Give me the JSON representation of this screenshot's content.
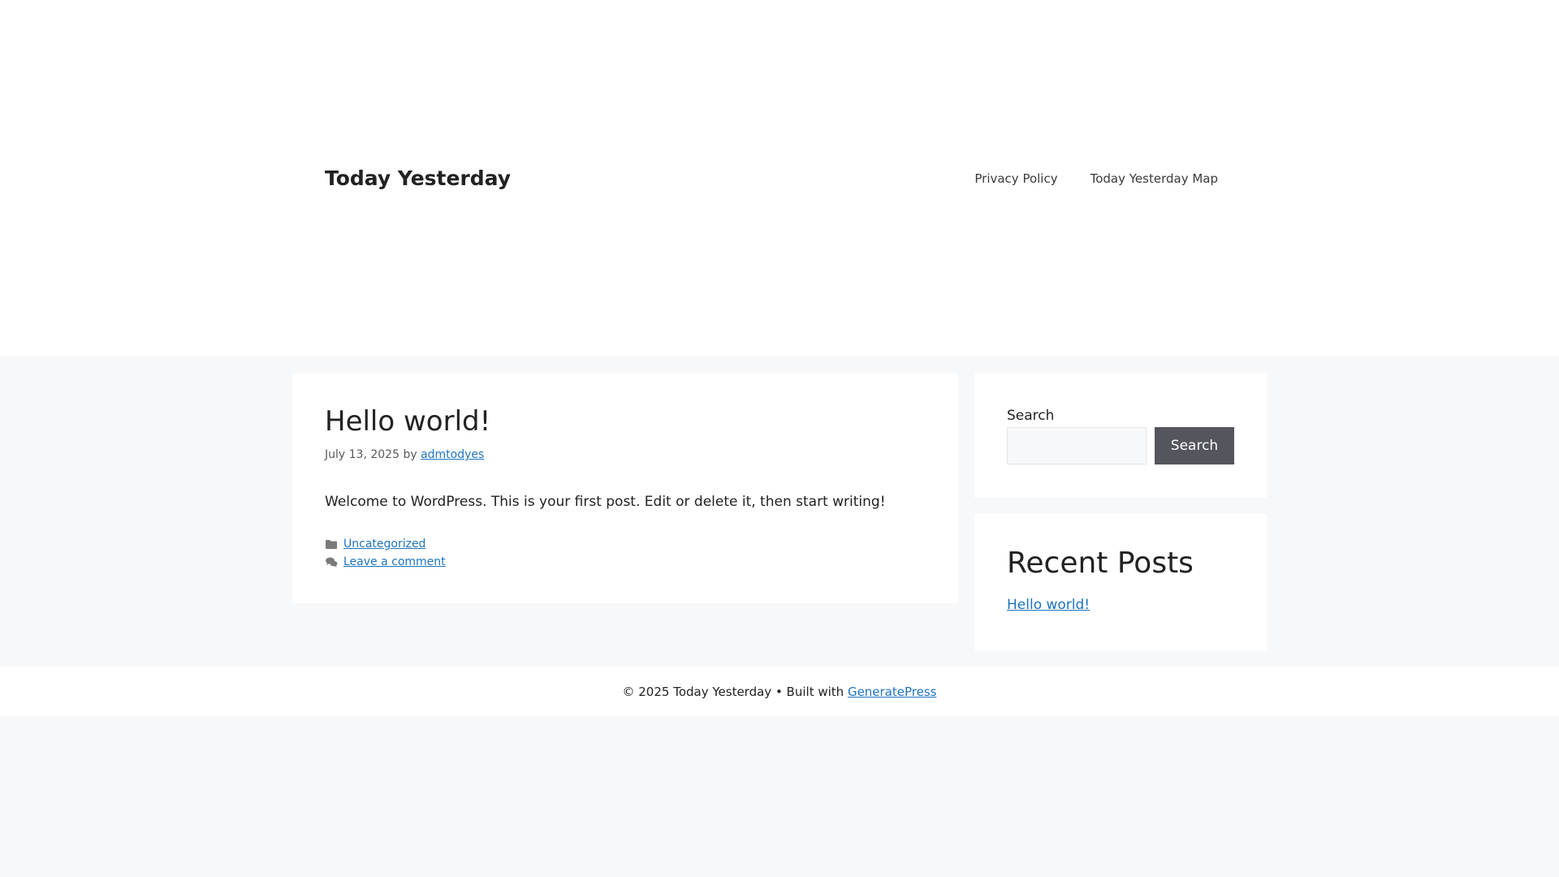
{
  "header": {
    "site_title": "Today Yesterday",
    "nav": [
      {
        "label": "Privacy Policy"
      },
      {
        "label": "Today Yesterday Map"
      }
    ]
  },
  "post": {
    "title": "Hello world!",
    "date": "July 13, 2025",
    "by": "by",
    "author": "admtodyes",
    "content": "Welcome to WordPress. This is your first post. Edit or delete it, then start writing!",
    "category": "Uncategorized",
    "comment_link": "Leave a comment",
    "category_icon": "folder-icon",
    "comment_icon": "comments-icon"
  },
  "sidebar": {
    "search": {
      "label": "Search",
      "placeholder": "",
      "value": "",
      "button_label": "Search"
    },
    "recent_posts": {
      "title": "Recent Posts",
      "items": [
        {
          "label": "Hello world!"
        }
      ]
    }
  },
  "footer": {
    "copyright": "© 2025 Today Yesterday • Built with",
    "theme_link": "GeneratePress"
  },
  "colors": {
    "link": "#1e73be",
    "page_background": "#f7f8f9",
    "button": "#55555e"
  }
}
